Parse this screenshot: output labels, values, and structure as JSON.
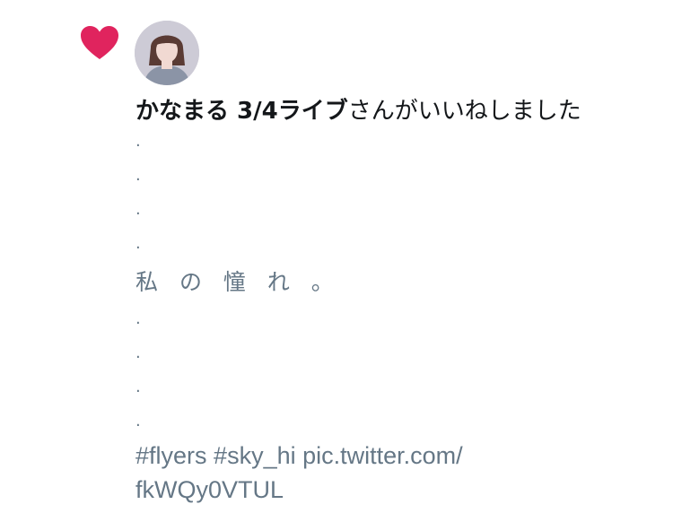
{
  "notification": {
    "type_icon": "heart-icon",
    "heart_color": "#e0245e",
    "avatar": "user-avatar",
    "user_name": "かなまる 3/4ライブ",
    "action_text": "さんがいいねしました"
  },
  "tweet": {
    "dots_top": [
      ".",
      ".",
      ".",
      "."
    ],
    "phrase": "私 の 憧 れ 。",
    "dots_bottom": [
      ".",
      ".",
      ".",
      "."
    ],
    "hashtags": [
      "#flyers",
      "#sky_hi"
    ],
    "link_line1": "pic.twitter.com/",
    "link_line2": "fkWQy0VTUL",
    "text_color": "#657786"
  }
}
